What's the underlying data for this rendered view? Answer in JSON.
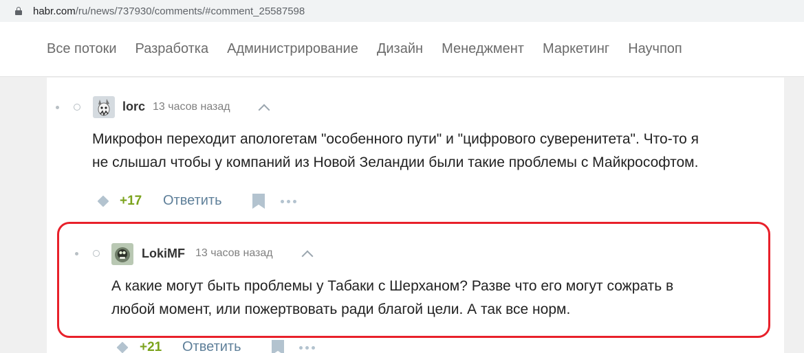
{
  "browser": {
    "url_host": "habr.com",
    "url_path": "/ru/news/737930/comments/#comment_25587598"
  },
  "nav": {
    "items": [
      "Все потоки",
      "Разработка",
      "Администрирование",
      "Дизайн",
      "Менеджмент",
      "Маркетинг",
      "Научпоп"
    ]
  },
  "comments": [
    {
      "author": "lorc",
      "time": "13 часов назад",
      "lines": [
        "Микрофон переходит апологетам \"особенного пути\" и \"цифрового суверенитета\". Что-то я",
        "не слышал чтобы у компаний из Новой Зеландии были такие проблемы с Майкрософтом."
      ],
      "votes": "+17",
      "reply_label": "Ответить"
    },
    {
      "author": "LokiMF",
      "time": "13 часов назад",
      "lines": [
        "А какие могут быть проблемы у Табаки с Шерханом? Разве что его могут сожрать в",
        "любой момент, или пожертвовать ради благой цели. А так все норм."
      ],
      "votes": "+21",
      "reply_label": "Ответить"
    }
  ],
  "colors": {
    "highlight": "#e8202a",
    "vote_positive": "#7ba31c",
    "reply_link": "#5e7f99"
  }
}
